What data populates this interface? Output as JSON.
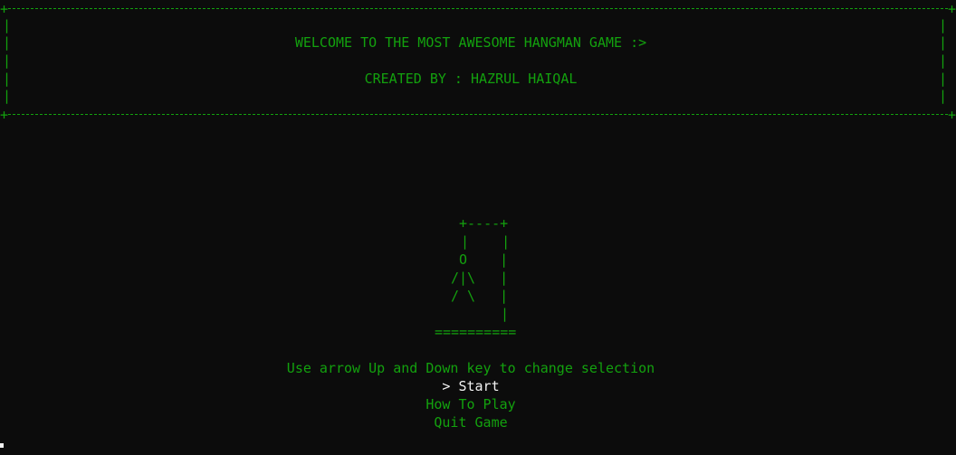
{
  "header": {
    "corner": "+",
    "side": "|",
    "welcome": "WELCOME TO THE MOST AWESOME HANGMAN GAME :>",
    "credit": "CREATED BY : HAZRUL HAIQAL"
  },
  "gallows": {
    "lines": [
      "+----+",
      "|    |",
      "O    |",
      "/|\\   |",
      "/ \\   |",
      "|",
      "=========="
    ]
  },
  "menu": {
    "instruction": "Use arrow Up and Down key to change selection",
    "items": [
      {
        "label": "> Start",
        "selected": true
      },
      {
        "label": "How To Play",
        "selected": false
      },
      {
        "label": "Quit Game",
        "selected": false
      }
    ]
  },
  "colors": {
    "background": "#0c0c0c",
    "text": "#13a10e",
    "selected": "#f2f2f2"
  }
}
